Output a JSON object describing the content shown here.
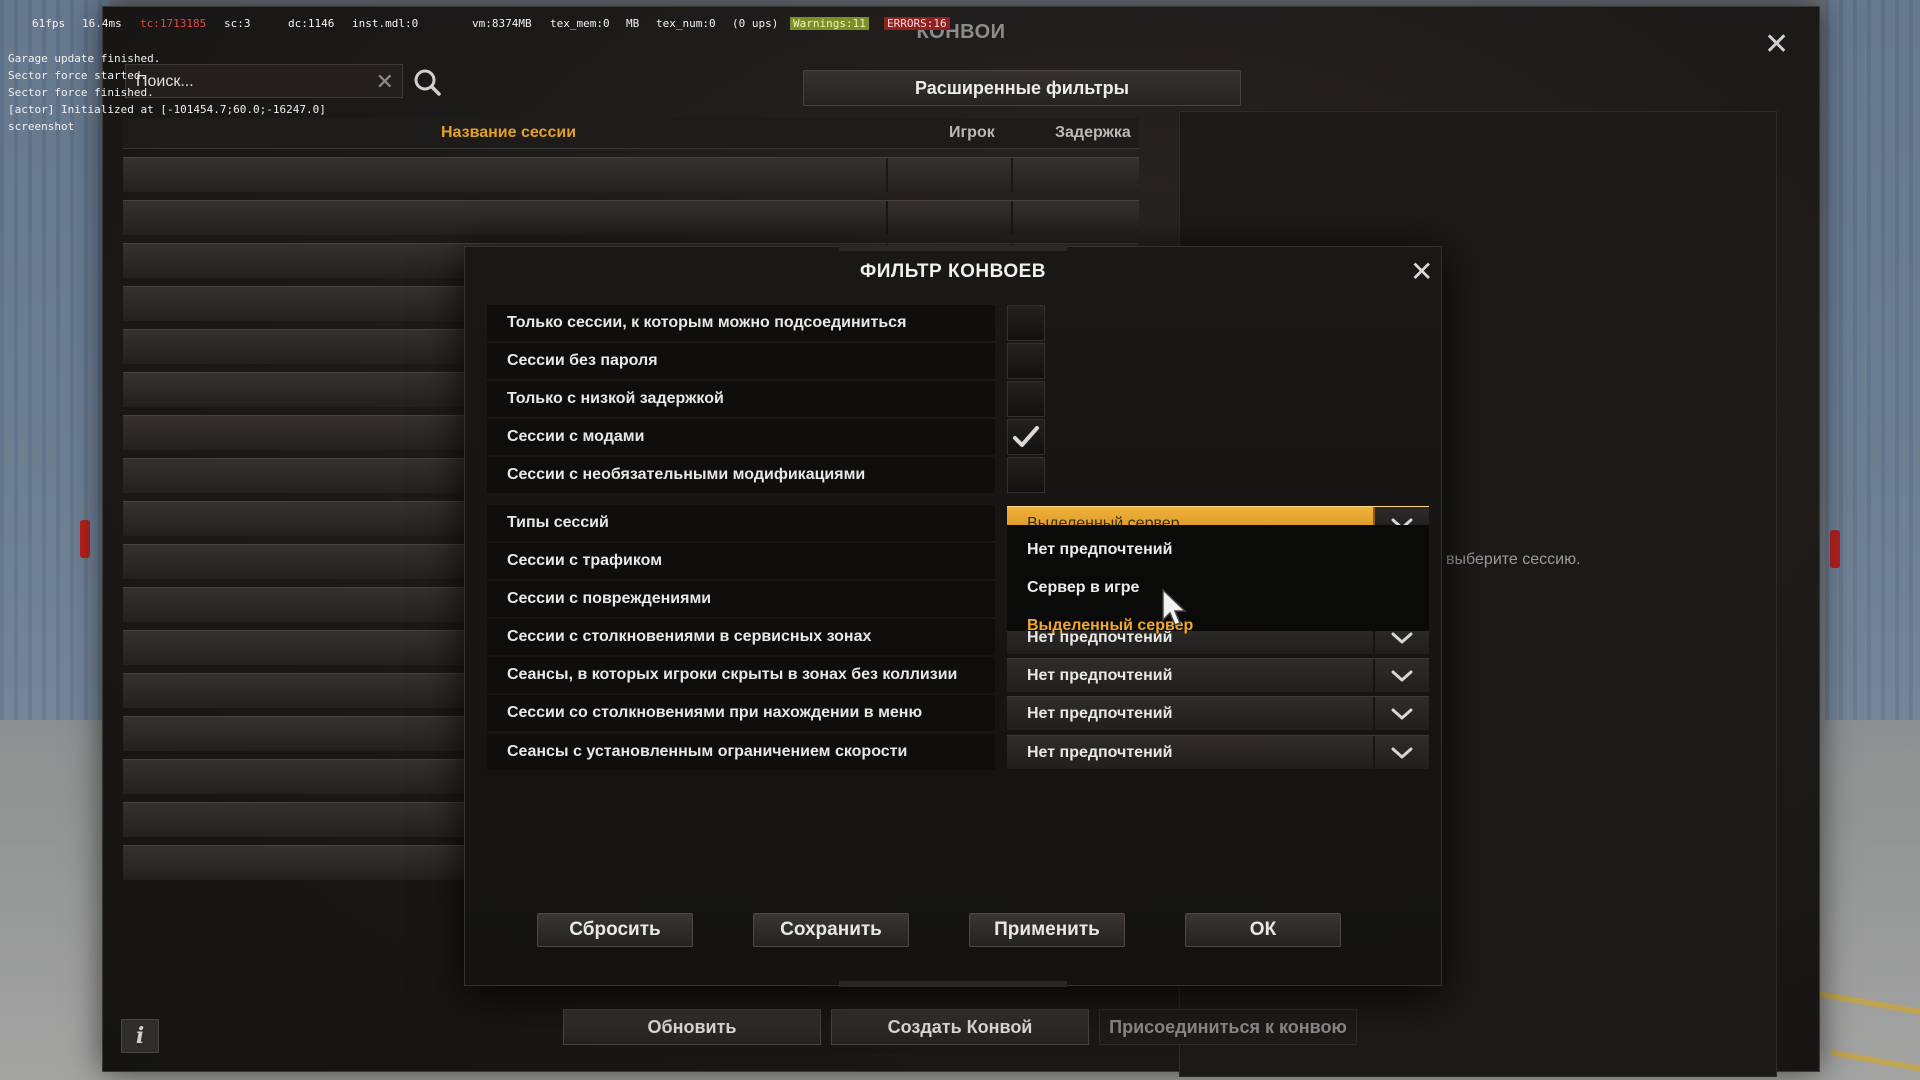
{
  "debug": {
    "fps": "61fps",
    "frame_ms": "16.4ms",
    "tc": "tc:1713185",
    "sc": "sc:3",
    "dc": "dc:1146",
    "inst": "inst.mdl:0",
    "vm": "vm:8374MB",
    "tex_mem": "tex_mem:0",
    "mb": "MB",
    "tex_num": "tex_num:0",
    "ups": "(0 ups)",
    "warnings": "Warnings:11",
    "errors": "ERRORS:16"
  },
  "console": [
    "Garage update finished.",
    "Sector force started.",
    "Sector force finished.",
    "[actor] Initialized at [-101454.7;60.0;-16247.0]",
    "screenshot"
  ],
  "main": {
    "title": "КОНВОИ",
    "search_placeholder": "Поиск...",
    "advanced_filters_label": "Расширенные фильтры",
    "columns": {
      "name": "Название сессии",
      "players": "Игрок",
      "ping": "Задержка"
    },
    "session_rows": 17,
    "info_message": "Пожалуйста, выберите сессию.",
    "buttons": {
      "refresh": "Обновить",
      "create": "Создать Конвой",
      "join": "Присоединиться к конвою"
    },
    "info_label": "i"
  },
  "modal": {
    "title": "ФИЛЬТР КОНВОЕВ",
    "checkboxes": [
      {
        "label": "Только сессии, к которым можно подсоединиться",
        "checked": false
      },
      {
        "label": "Сессии без пароля",
        "checked": false
      },
      {
        "label": "Только с низкой задержкой",
        "checked": false
      },
      {
        "label": "Сессии с модами",
        "checked": true
      },
      {
        "label": "Сессии с необязательными модификациями",
        "checked": false
      }
    ],
    "dropdowns": [
      {
        "label": "Типы сессий",
        "value": "Выделенный сервер",
        "open": true
      },
      {
        "label": "Сессии с трафиком",
        "value": ""
      },
      {
        "label": "Сессии с повреждениями",
        "value": ""
      },
      {
        "label": "Сессии с столкновениями в сервисных зонах",
        "value": "Нет предпочтений"
      },
      {
        "label": "Сеансы, в которых игроки скрыты в зонах без коллизии",
        "value": "Нет предпочтений"
      },
      {
        "label": "Сессии со столкновениями при нахождении в меню",
        "value": "Нет предпочтений"
      },
      {
        "label": "Сеансы с установленным ограничением скорости",
        "value": "Нет предпочтений"
      }
    ],
    "open_options": [
      "Нет предпочтений",
      "Сервер в игре",
      "Выделенный сервер"
    ],
    "open_selected_index": 2,
    "buttons": {
      "reset": "Сбросить",
      "save": "Сохранить",
      "apply": "Применить",
      "ok": "ОК"
    }
  },
  "colors": {
    "accent": "#f0a72a",
    "checkmark": "#d9d9d9"
  }
}
